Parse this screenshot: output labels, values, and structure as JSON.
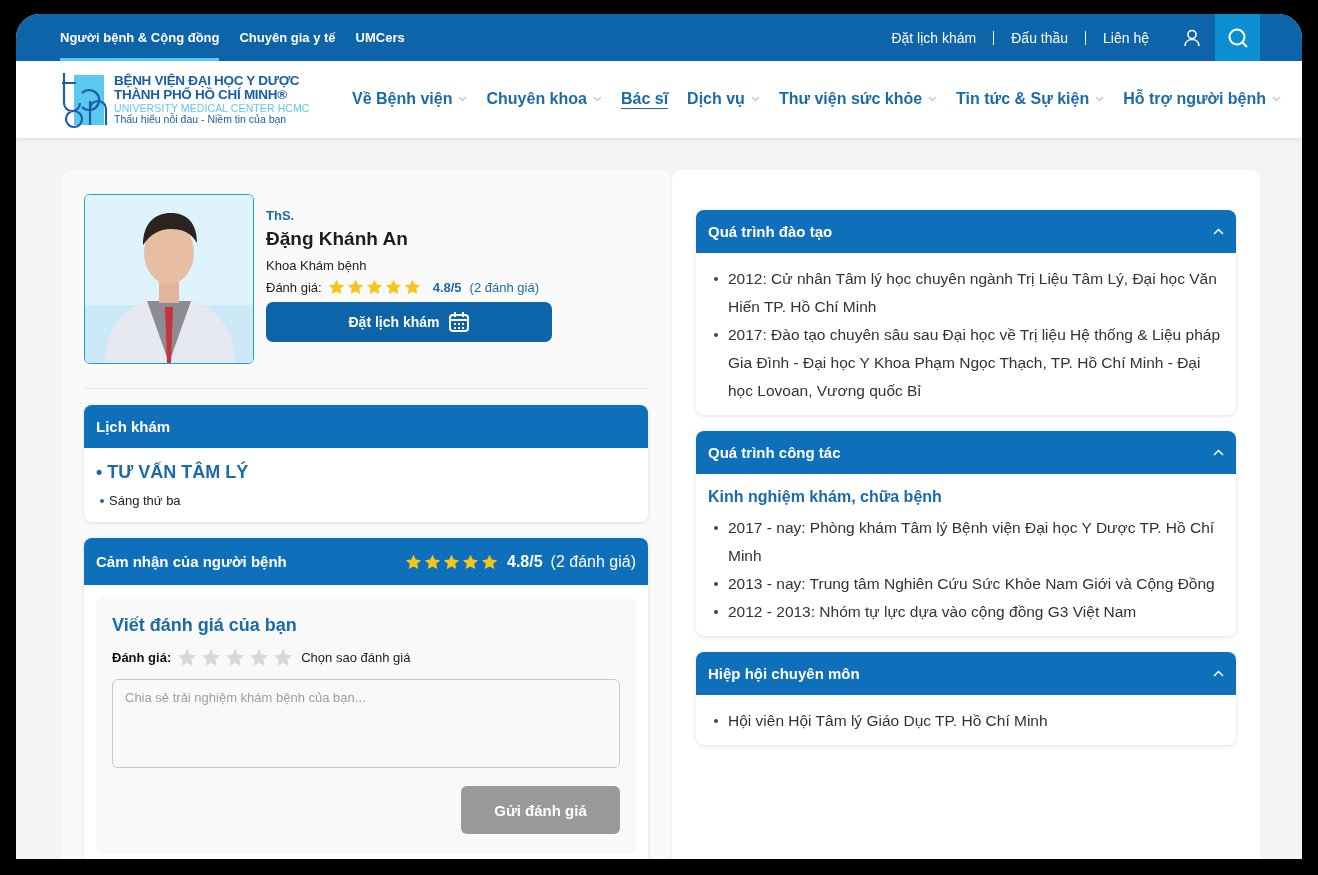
{
  "top_bar": {
    "tabs": [
      {
        "label": "Người bệnh & Cộng đồng",
        "selected": true
      },
      {
        "label": "Chuyên gia y tế",
        "selected": false
      },
      {
        "label": "UMCers",
        "selected": false
      }
    ],
    "links": [
      "Đặt lịch khám",
      "Đấu thầu",
      "Liên hệ"
    ]
  },
  "logo": {
    "line_1": "BỆNH VIỆN ĐẠI HỌC Y DƯỢC",
    "line_2": "THÀNH PHỐ HỒ CHÍ MINH®",
    "line_3": "UNIVERSITY MEDICAL CENTER HCMC",
    "slogan": "Thấu hiểu nỗi đau - Niềm tin của bạn"
  },
  "nav": [
    {
      "label": "Về Bệnh viện",
      "selected": false,
      "dropdown": true
    },
    {
      "label": "Chuyên khoa",
      "selected": false,
      "dropdown": true
    },
    {
      "label": "Bác sĩ",
      "selected": true,
      "dropdown": false
    },
    {
      "label": "Dịch vụ",
      "selected": false,
      "dropdown": true
    },
    {
      "label": "Thư viện sức khỏe",
      "selected": false,
      "dropdown": true
    },
    {
      "label": "Tin tức & Sự kiện",
      "selected": false,
      "dropdown": true
    },
    {
      "label": "Hỗ trợ người bệnh",
      "selected": false,
      "dropdown": true
    }
  ],
  "doctor": {
    "title": "ThS.",
    "name": "Đặng Khánh An",
    "department": "Khoa Khám bệnh",
    "rating_label": "Đánh giá:",
    "stars": 5,
    "score": "4.8/5",
    "count": "(2 đánh giá)",
    "book_button": "Đặt lịch khám"
  },
  "schedule": {
    "title": "Lịch khám",
    "service": "• TƯ VẤN TÂM LÝ",
    "times": [
      "Sáng thứ ba"
    ]
  },
  "reviews": {
    "title": "Cảm nhận của người bệnh",
    "stars": 5,
    "score": "4.8/5",
    "count": "(2 đánh giá)",
    "form": {
      "title": "Viết đánh giá của bạn",
      "rating_label": "Đánh giá:",
      "stars": 0,
      "hint": "Chọn sao đánh giá",
      "placeholder": "Chia sẻ trải nghiệm khám bệnh của bạn...",
      "submit": "Gửi đánh giá",
      "submit_disabled": true
    }
  },
  "sections": [
    {
      "title": "Quá trình đào tạo",
      "expanded": true,
      "items": [
        "2012: Cử nhân Tâm lý học chuyên ngành Trị Liệu Tâm Lý, Đại học Văn Hiến TP. Hồ Chí Minh",
        "2017: Đào tạo chuyên sâu sau Đại học về Trị liệu Hệ thống & Liệu pháp Gia Đình - Đại học Y Khoa Phạm Ngọc Thạch, TP. Hồ Chí Minh - Đại học Lovoan, Vương quốc Bỉ"
      ]
    },
    {
      "title": "Quá trình công tác",
      "expanded": true,
      "subtitle": "Kinh nghiệm khám, chữa bệnh",
      "items": [
        "2017 - nay: Phòng khám Tâm lý Bệnh viện Đại học Y Dược TP. Hồ Chí Minh",
        "2013 - nay: Trung tâm Nghiên Cứu Sức Khỏe Nam Giới và Cộng Đồng",
        "2012 - 2013: Nhóm tự lực dựa vào cộng đồng G3 Việt Nam"
      ]
    },
    {
      "title": "Hiệp hội chuyên môn",
      "expanded": true,
      "items": [
        "Hội viên Hội Tâm lý Giáo Dục TP. Hồ Chí Minh"
      ]
    }
  ]
}
